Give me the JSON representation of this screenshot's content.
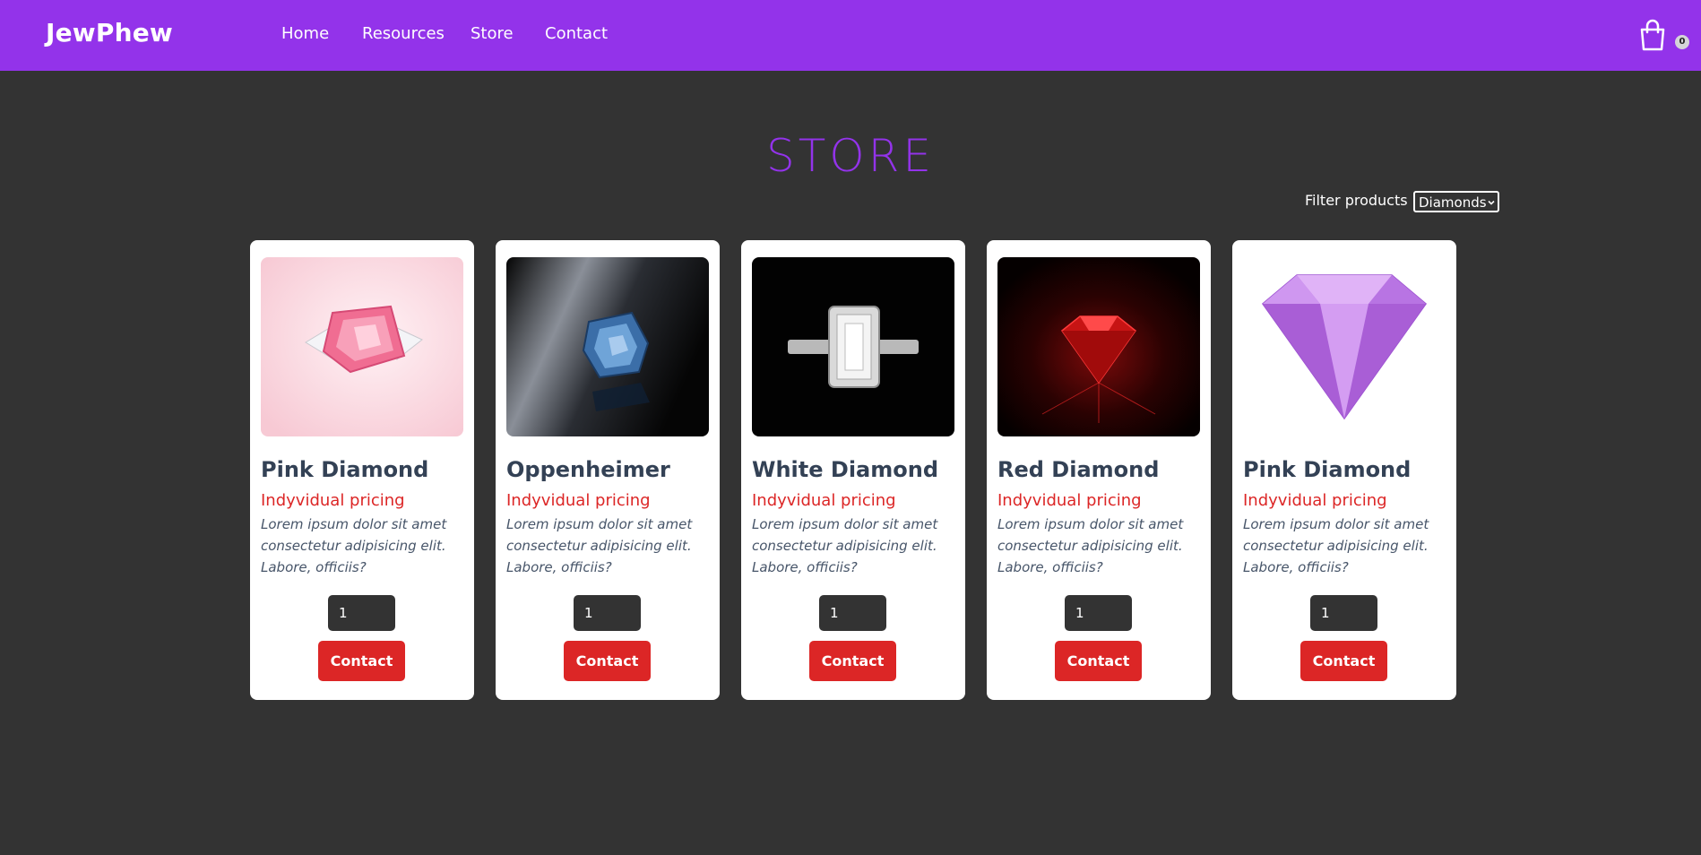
{
  "nav": {
    "brand": "JewPhew",
    "links": [
      "Home",
      "Resources",
      "Store",
      "Contact"
    ],
    "cart_count": "0"
  },
  "page": {
    "title": "STORE",
    "filter_label": "Filter products",
    "filter_value": "Diamonds"
  },
  "products": [
    {
      "name": "Pink Diamond",
      "price": "Indyvidual pricing",
      "description": "Lorem ipsum dolor sit amet consectetur adipisicing elit. Labore, officiis?",
      "quantity": "1",
      "button": "Contact"
    },
    {
      "name": "Oppenheimer",
      "price": "Indyvidual pricing",
      "description": "Lorem ipsum dolor sit amet consectetur adipisicing elit. Labore, officiis?",
      "quantity": "1",
      "button": "Contact"
    },
    {
      "name": "White Diamond",
      "price": "Indyvidual pricing",
      "description": "Lorem ipsum dolor sit amet consectetur adipisicing elit. Labore, officiis?",
      "quantity": "1",
      "button": "Contact"
    },
    {
      "name": "Red Diamond",
      "price": "Indyvidual pricing",
      "description": "Lorem ipsum dolor sit amet consectetur adipisicing elit. Labore, officiis?",
      "quantity": "1",
      "button": "Contact"
    },
    {
      "name": "Pink Diamond",
      "price": "Indyvidual pricing",
      "description": "Lorem ipsum dolor sit amet consectetur adipisicing elit. Labore, officiis?",
      "quantity": "1",
      "button": "Contact"
    }
  ],
  "colors": {
    "accent": "#9333ea",
    "background": "#333333",
    "price": "#dc2626",
    "button": "#dc2626"
  }
}
